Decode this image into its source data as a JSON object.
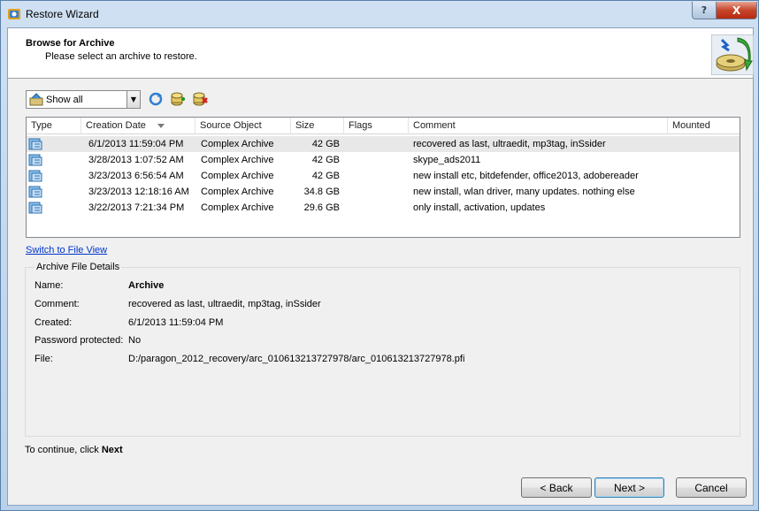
{
  "window": {
    "title": "Restore Wizard",
    "help_label": "?",
    "close_label": "X"
  },
  "header": {
    "title": "Browse for Archive",
    "subtitle": "Please select an archive to restore."
  },
  "toolbar": {
    "filter_value": "Show all",
    "icons": [
      "refresh-icon",
      "add-archive-icon",
      "remove-archive-icon"
    ]
  },
  "archive_list": {
    "columns": [
      "Type",
      "Creation Date",
      "Source Object",
      "Size",
      "Flags",
      "Comment",
      "Mounted"
    ],
    "sorted_column": "Creation Date",
    "rows": [
      {
        "date": "6/1/2013 11:59:04 PM",
        "source": "Complex Archive",
        "size": "42 GB",
        "flags": "",
        "comment": "recovered as last, ultraedit, mp3tag, inSsider",
        "mounted": "",
        "selected": true
      },
      {
        "date": "3/28/2013 1:07:52 AM",
        "source": "Complex Archive",
        "size": "42 GB",
        "flags": "",
        "comment": "skype_ads2011",
        "mounted": "",
        "selected": false
      },
      {
        "date": "3/23/2013 6:56:54 AM",
        "source": "Complex Archive",
        "size": "42 GB",
        "flags": "",
        "comment": "new install etc, bitdefender, office2013, adobereader",
        "mounted": "",
        "selected": false
      },
      {
        "date": "3/23/2013 12:18:16 AM",
        "source": "Complex Archive",
        "size": "34.8 GB",
        "flags": "",
        "comment": "new install, wlan driver, many updates. nothing else",
        "mounted": "",
        "selected": false
      },
      {
        "date": "3/22/2013 7:21:34 PM",
        "source": "Complex Archive",
        "size": "29.6 GB",
        "flags": "",
        "comment": "only install, activation, updates",
        "mounted": "",
        "selected": false
      }
    ]
  },
  "switch_link": "Switch to File View",
  "details": {
    "title": "Archive File Details",
    "name_label": "Name:",
    "name_value": "Archive",
    "comment_label": "Comment:",
    "comment_value": "recovered as last, ultraedit, mp3tag, inSsider",
    "created_label": "Created:",
    "created_value": "6/1/2013 11:59:04 PM",
    "password_label": "Password protected:",
    "password_value": "No",
    "file_label": "File:",
    "file_value": "D:/paragon_2012_recovery/arc_010613213727978/arc_010613213727978.pfi"
  },
  "footer": {
    "continue_text": "To continue, click",
    "continue_bold": "Next",
    "back_label": "< Back",
    "next_label": "Next >",
    "cancel_label": "Cancel"
  },
  "colors": {
    "link": "#0033cc",
    "selected_row": "#e8e8e8",
    "window_frame": "#b9d1ea"
  }
}
